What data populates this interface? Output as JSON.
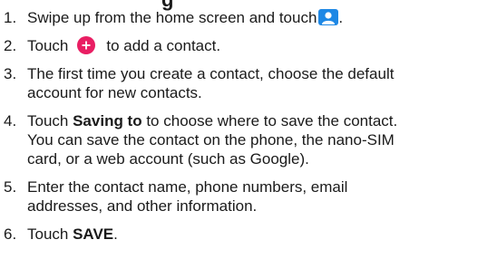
{
  "heading_fragment": "g",
  "steps": [
    {
      "number": "1.",
      "text_before": "Swipe up from the home screen and touch",
      "text_after": "."
    },
    {
      "number": "2.",
      "text_before": "Touch",
      "text_after": "to add a contact."
    },
    {
      "number": "3.",
      "line1": "The first time you create a contact, choose the default",
      "line2": "account for new contacts."
    },
    {
      "number": "4.",
      "prefix": "Touch ",
      "bold": "Saving to",
      "line1_rest": " to choose where to save the contact.",
      "line2": "You can save the contact on the phone, the nano-SIM",
      "line3": "card, or a web account (such as Google)."
    },
    {
      "number": "5.",
      "line1": "Enter the contact name, phone numbers, email",
      "line2": "addresses, and other information."
    },
    {
      "number": "6.",
      "prefix": "Touch ",
      "bold": "SAVE",
      "suffix": "."
    }
  ],
  "icons": {
    "contacts": {
      "name": "contacts-app-icon",
      "color": "#1e88e5"
    },
    "add": {
      "name": "add-contact-icon",
      "color": "#e91e63"
    }
  }
}
